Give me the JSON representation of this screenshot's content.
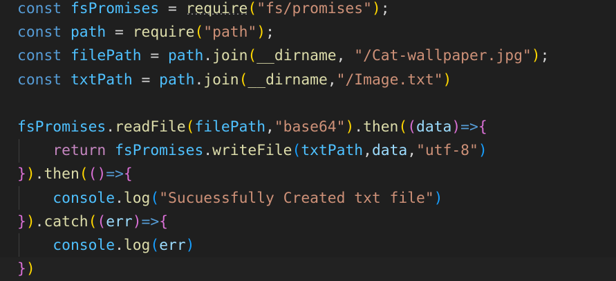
{
  "editor": {
    "theme_colors": {
      "background": "#1f1f1f",
      "keyword": "#569cd6",
      "control_keyword": "#c586c0",
      "variable": "#4fc1ff",
      "function": "#dcdcaa",
      "parameter": "#9cdcfe",
      "string": "#ce9178",
      "bracket_level_1": "#ffd700",
      "bracket_level_2": "#da70d6",
      "bracket_level_3": "#179fff"
    },
    "lines": [
      "const fsPromises = require(\"fs/promises\");",
      "const path = require(\"path\");",
      "const filePath = path.join(__dirname, \"/Cat-wallpaper.jpg\");",
      "const txtPath = path.join(__dirname,\"/Image.txt\")",
      "",
      "fsPromises.readFile(filePath,\"base64\").then((data)=>{",
      "    return fsPromises.writeFile(txtPath,data,\"utf-8\")",
      "}).then(()=>{",
      "    console.log(\"Sucuessfully Created txt file\")",
      "}).catch((err)=>{",
      "    console.log(err)",
      "})"
    ],
    "tokens": {
      "l1": [
        "const",
        " ",
        "fsPromises",
        " = ",
        "require",
        "(",
        "\"fs/promises\"",
        ")",
        ";"
      ],
      "l2": [
        "const",
        " ",
        "path",
        " = ",
        "require",
        "(",
        "\"path\"",
        ")",
        ";"
      ],
      "l3": [
        "const",
        " ",
        "filePath",
        " = ",
        "path",
        ".",
        "join",
        "(",
        "__dirname",
        ", ",
        "\"/Cat-wallpaper.jpg\"",
        ")",
        ";"
      ],
      "l4": [
        "const",
        " ",
        "txtPath",
        " = ",
        "path",
        ".",
        "join",
        "(",
        "__dirname",
        ",",
        "\"/Image.txt\"",
        ")"
      ],
      "l6": [
        "fsPromises",
        ".",
        "readFile",
        "(",
        "filePath",
        ",",
        "\"base64\"",
        ")",
        ".",
        "then",
        "(",
        "(",
        "data",
        ")",
        "=>",
        "{"
      ],
      "l7": [
        "    ",
        "return",
        " ",
        "fsPromises",
        ".",
        "writeFile",
        "(",
        "txtPath",
        ",",
        "data",
        ",",
        "\"utf-8\"",
        ")"
      ],
      "l8": [
        "}",
        ")",
        ".",
        "then",
        "(",
        "(",
        ")",
        "=>",
        "{"
      ],
      "l9": [
        "    ",
        "console",
        ".",
        "log",
        "(",
        "\"Sucuessfully Created txt file\"",
        ")"
      ],
      "l10": [
        "}",
        ")",
        ".",
        "catch",
        "(",
        "(",
        "err",
        ")",
        "=>",
        "{"
      ],
      "l11": [
        "    ",
        "console",
        ".",
        "log",
        "(",
        "err",
        ")"
      ],
      "l12": [
        "}",
        ")"
      ]
    }
  }
}
